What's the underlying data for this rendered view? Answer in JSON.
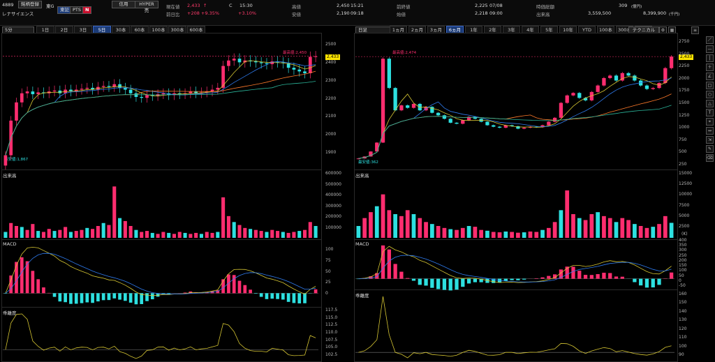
{
  "header": {
    "code": "4889",
    "btn_indicators": "銘柄登録",
    "market": "東G",
    "btn_tse": "東証",
    "btn_pts": "PTS",
    "n_label": "N",
    "company": "レナサイエンス",
    "credit": "信用",
    "hyper": "HYPER売",
    "cur_label": "現在値",
    "cur_val": "2,433",
    "cur_arrow": "↑",
    "c_label": "C",
    "cur_time": "15:30",
    "chg_label": "前日比",
    "chg_val": "+208",
    "chg_pct": "+9.35%",
    "chg_pct2": "+3.10%",
    "high_label": "高値",
    "high_val": "2,450",
    "high_time": "15:21",
    "low_label": "安値",
    "low_val": "2,190",
    "low_time": "09:18",
    "prev_label": "前終値",
    "prev_val": "2,225",
    "prev_date": "07/08",
    "open_label": "始値",
    "open_val": "2,218",
    "open_time": "09:00",
    "mcap_label": "時価総額",
    "mcap_val": "309",
    "mcap_unit": "(億円)",
    "vol_label": "出来高",
    "vol_val": "3,559,500",
    "turnover_val": "8,399,900",
    "turnover_unit": "(千円)"
  },
  "left": {
    "interval": "5分",
    "chart_type": "ローソク足",
    "tabs": [
      "1日",
      "2日",
      "3日",
      "5日",
      "30本",
      "60本",
      "100本",
      "300本",
      "600本"
    ],
    "active_tab": "5日",
    "price_axis": [
      "2500",
      "2400",
      "2300",
      "2200",
      "2100",
      "2000",
      "1900"
    ],
    "price_tag": "2,433",
    "high_anno": "最高値:2,450",
    "low_anno": "最安値:1,867",
    "vol_title": "出来高",
    "vol_axis": [
      "600000",
      "500000",
      "400000",
      "300000",
      "200000",
      "100000"
    ],
    "macd_title": "MACD",
    "macd_axis": [
      "100",
      "75",
      "50",
      "25",
      "0"
    ],
    "ratio_title": "乖離度",
    "ratio_axis": [
      "117.5",
      "115.0",
      "112.5",
      "110.0",
      "107.5",
      "105.0",
      "102.5"
    ]
  },
  "right": {
    "interval": "日足",
    "tabs": [
      "1ヵ月",
      "2ヵ月",
      "3ヵ月",
      "6ヵ月",
      "1年",
      "2年",
      "3年",
      "4年",
      "5年",
      "10年",
      "YTD",
      "100本",
      "300本",
      "600本"
    ],
    "active_tab": "6ヵ月",
    "tech_btn": "テクニカル",
    "price_axis": [
      "2750",
      "2500",
      "2250",
      "2000",
      "1750",
      "1500",
      "1250",
      "1000",
      "750",
      "500",
      "250"
    ],
    "price_tag": "2,433",
    "high_anno": "最高値:2,474",
    "low_anno": "最安値:362",
    "vol_title": "出来高",
    "vol_axis": [
      "15000",
      "12500",
      "10000",
      "7500",
      "5000",
      "2500"
    ],
    "vol_unit": "(K)",
    "macd_title": "MACD",
    "macd_axis": [
      "400",
      "350",
      "300",
      "250",
      "200",
      "150",
      "100",
      "50",
      "0",
      "-50"
    ],
    "ratio_title": "乖離度",
    "ratio_axis": [
      "160",
      "150",
      "140",
      "130",
      "120",
      "110",
      "100",
      "90"
    ]
  },
  "colors": {
    "up": "#ff2d6f",
    "down": "#2de0e0",
    "ma_short": "#d6c632",
    "ma_mid": "#2f7cf0",
    "ma_long1": "#ff7a2a",
    "ma_long2": "#2bb59a",
    "macd": "#d6c632",
    "signal": "#2f7cf0",
    "accent": "#ffe600"
  },
  "chart_data": [
    {
      "type": "candlestick",
      "title": "5分",
      "xlabel": "",
      "ylabel": "",
      "ylim": [
        1850,
        2520
      ],
      "close": [
        1890,
        2080,
        2180,
        2230,
        2240,
        2225,
        2235,
        2230,
        2240,
        2245,
        2230,
        2250,
        2240,
        2250,
        2255,
        2260,
        2250,
        2265,
        2270,
        2265,
        2280,
        2260,
        2250,
        2230,
        2210,
        2205,
        2220,
        2215,
        2225,
        2230,
        2220,
        2230,
        2225,
        2230,
        2240,
        2230,
        2235,
        2240,
        2250,
        2260,
        2380,
        2410,
        2420,
        2400,
        2410,
        2405,
        2400,
        2395,
        2390,
        2405,
        2400,
        2395,
        2370,
        2360,
        2350,
        2340,
        2430,
        2433
      ]
    },
    {
      "type": "bar",
      "title": "出来高",
      "ylim": [
        0,
        600000
      ],
      "values": [
        60000,
        150000,
        120000,
        110000,
        80000,
        140000,
        70000,
        60000,
        90000,
        70000,
        80000,
        110000,
        60000,
        70000,
        80000,
        100000,
        90000,
        120000,
        150000,
        130000,
        520000,
        200000,
        170000,
        120000,
        80000,
        60000,
        70000,
        50000,
        40000,
        60000,
        50000,
        40000,
        60000,
        50000,
        40000,
        50000,
        40000,
        60000,
        50000,
        60000,
        410000,
        220000,
        160000,
        130000,
        100000,
        90000,
        80000,
        70000,
        60000,
        80000,
        70000,
        60000,
        50000,
        60000,
        70000,
        80000,
        160000,
        120000
      ]
    },
    {
      "type": "candlestick",
      "title": "日足",
      "xlabel": "",
      "ylabel": "",
      "ylim": [
        200,
        2800
      ],
      "close": [
        380,
        420,
        520,
        700,
        2390,
        1800,
        1350,
        1450,
        1400,
        1480,
        1350,
        1420,
        1300,
        1250,
        1180,
        1100,
        1080,
        1150,
        1220,
        1180,
        1120,
        1050,
        1020,
        1000,
        1050,
        1030,
        980,
        1000,
        1020,
        1010,
        1050,
        1120,
        1200,
        1500,
        1650,
        1700,
        1600,
        1550,
        1720,
        1850,
        2000,
        2050,
        1950,
        2100,
        2050,
        1950,
        1850,
        1780,
        1800,
        1900,
        2200,
        2433
      ]
    },
    {
      "type": "bar",
      "title": "出来高",
      "ylim": [
        0,
        15000
      ],
      "values": [
        3000,
        5000,
        6500,
        8000,
        11000,
        7000,
        6000,
        5500,
        7000,
        6000,
        5000,
        4000,
        3500,
        3000,
        2500,
        2200,
        2000,
        2500,
        3000,
        2800,
        2000,
        1800,
        1500,
        1400,
        1600,
        1500,
        1300,
        1400,
        1600,
        1500,
        2000,
        2500,
        4000,
        7000,
        12000,
        6000,
        5000,
        4500,
        6000,
        6500,
        5500,
        5000,
        4000,
        5000,
        4500,
        3500,
        3000,
        2500,
        2800,
        3500,
        5500,
        3800
      ]
    }
  ]
}
